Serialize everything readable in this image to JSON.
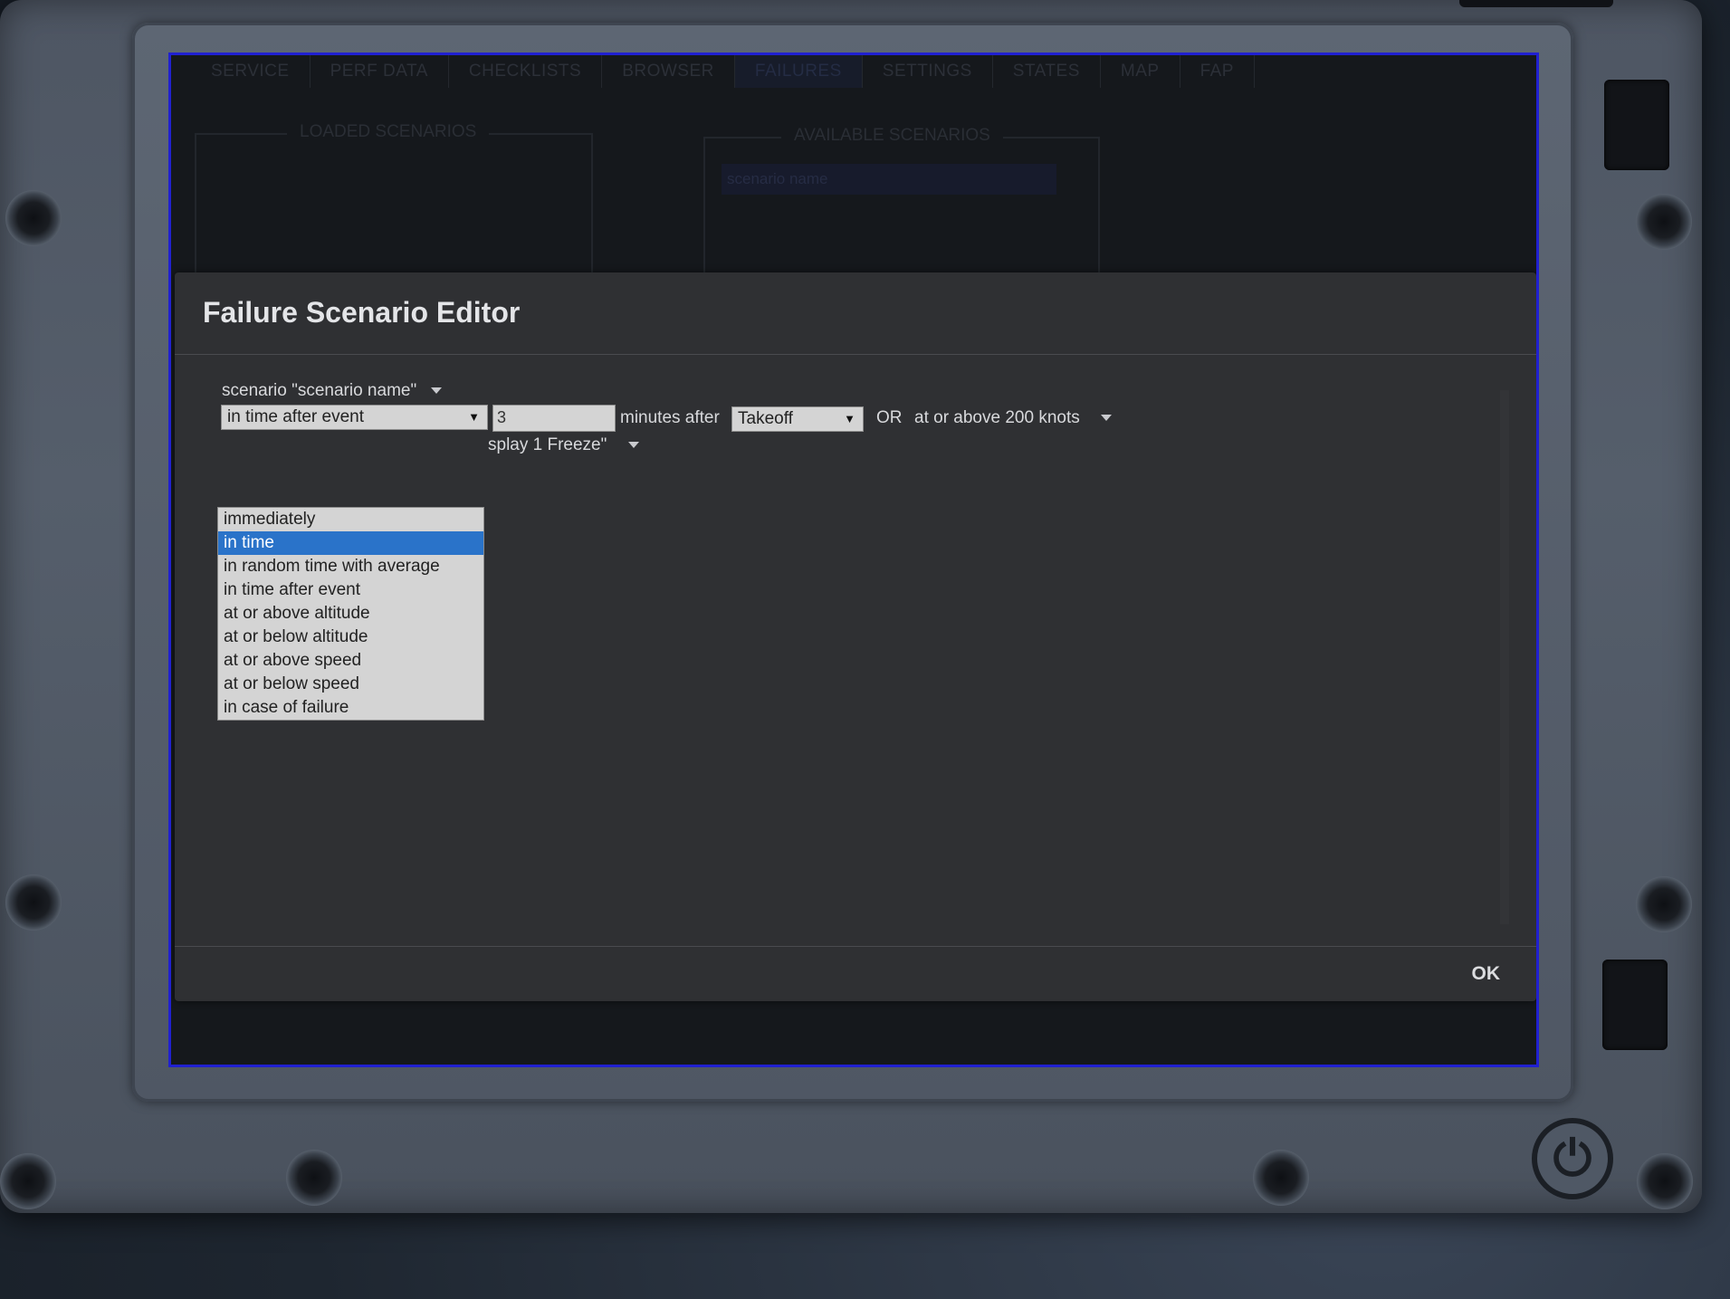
{
  "nav": {
    "tabs": [
      {
        "label": "SERVICE"
      },
      {
        "label": "PERF DATA"
      },
      {
        "label": "CHECKLISTS"
      },
      {
        "label": "BROWSER"
      },
      {
        "label": "FAILURES",
        "active": true
      },
      {
        "label": "SETTINGS"
      },
      {
        "label": "STATES"
      },
      {
        "label": "MAP"
      },
      {
        "label": "FAP"
      }
    ]
  },
  "panels": {
    "loaded_title": "LOADED SCENARIOS",
    "available_title": "AVAILABLE SCENARIOS",
    "available_item": "scenario name"
  },
  "modal": {
    "title": "Failure Scenario Editor",
    "scenario_label": "scenario \"scenario name\"",
    "condition_select": "in time after event",
    "minutes_value": "3",
    "minutes_after_label": "minutes after",
    "event_select": "Takeoff",
    "or_label": "OR",
    "speed_condition": "at or above 200 knots",
    "failure_label": "splay 1 Freeze\"",
    "ok_label": "OK"
  },
  "dropdown": {
    "selected": "in time",
    "options": [
      "immediately",
      "in time",
      "in random time with average",
      "in time after event",
      "at or above altitude",
      "at or below altitude",
      "at or above speed",
      "at or below speed",
      "in case of failure"
    ]
  },
  "icons": {
    "power": "power-icon",
    "caret": "caret-down-icon"
  },
  "colors": {
    "selection": "#2a73c9",
    "screen_border": "#2020d0"
  }
}
